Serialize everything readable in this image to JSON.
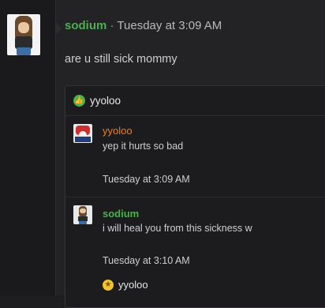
{
  "post": {
    "username": "sodium",
    "separator": "·",
    "timestamp": "Tuesday at 3:09 AM",
    "message": "are u still sick mommy"
  },
  "reply_box": {
    "header_user": "yyoloo",
    "header_icon": "like-icon",
    "entries": [
      {
        "username": "yyoloo",
        "text": "yep it hurts so bad",
        "time": "Tuesday at 3:09 AM",
        "name_color": "#f07c1e"
      },
      {
        "username": "sodium",
        "text": "i will heal you from this sickness w",
        "time": "Tuesday at 3:10 AM",
        "name_color": "#4caf50"
      }
    ],
    "reaction": {
      "icon": "star-icon",
      "username": "yyoloo"
    }
  },
  "colors": {
    "accent_green": "#4caf50",
    "accent_orange": "#f07c1e",
    "background": "#1e1e21"
  }
}
